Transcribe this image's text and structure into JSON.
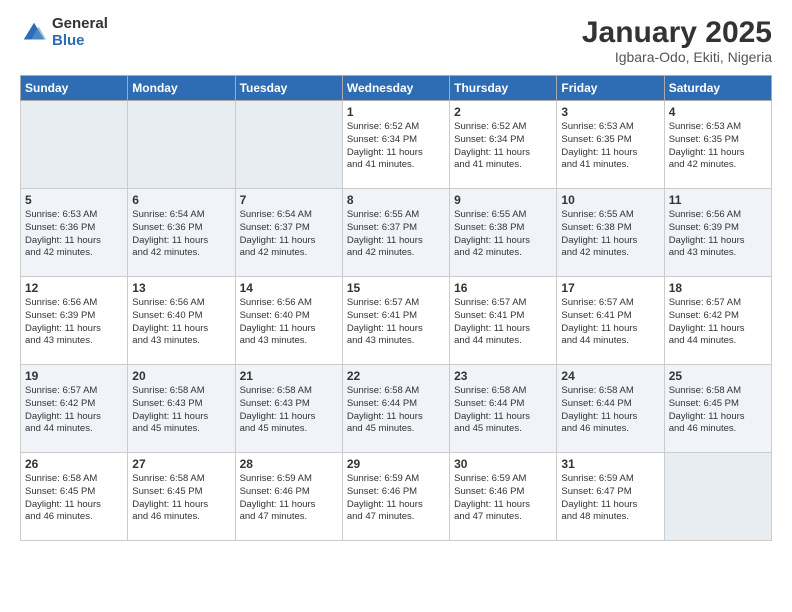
{
  "header": {
    "logo_general": "General",
    "logo_blue": "Blue",
    "title": "January 2025",
    "subtitle": "Igbara-Odo, Ekiti, Nigeria"
  },
  "days_header": [
    "Sunday",
    "Monday",
    "Tuesday",
    "Wednesday",
    "Thursday",
    "Friday",
    "Saturday"
  ],
  "weeks": [
    [
      {
        "day": "",
        "info": ""
      },
      {
        "day": "",
        "info": ""
      },
      {
        "day": "",
        "info": ""
      },
      {
        "day": "1",
        "info": "Sunrise: 6:52 AM\nSunset: 6:34 PM\nDaylight: 11 hours\nand 41 minutes."
      },
      {
        "day": "2",
        "info": "Sunrise: 6:52 AM\nSunset: 6:34 PM\nDaylight: 11 hours\nand 41 minutes."
      },
      {
        "day": "3",
        "info": "Sunrise: 6:53 AM\nSunset: 6:35 PM\nDaylight: 11 hours\nand 41 minutes."
      },
      {
        "day": "4",
        "info": "Sunrise: 6:53 AM\nSunset: 6:35 PM\nDaylight: 11 hours\nand 42 minutes."
      }
    ],
    [
      {
        "day": "5",
        "info": "Sunrise: 6:53 AM\nSunset: 6:36 PM\nDaylight: 11 hours\nand 42 minutes."
      },
      {
        "day": "6",
        "info": "Sunrise: 6:54 AM\nSunset: 6:36 PM\nDaylight: 11 hours\nand 42 minutes."
      },
      {
        "day": "7",
        "info": "Sunrise: 6:54 AM\nSunset: 6:37 PM\nDaylight: 11 hours\nand 42 minutes."
      },
      {
        "day": "8",
        "info": "Sunrise: 6:55 AM\nSunset: 6:37 PM\nDaylight: 11 hours\nand 42 minutes."
      },
      {
        "day": "9",
        "info": "Sunrise: 6:55 AM\nSunset: 6:38 PM\nDaylight: 11 hours\nand 42 minutes."
      },
      {
        "day": "10",
        "info": "Sunrise: 6:55 AM\nSunset: 6:38 PM\nDaylight: 11 hours\nand 42 minutes."
      },
      {
        "day": "11",
        "info": "Sunrise: 6:56 AM\nSunset: 6:39 PM\nDaylight: 11 hours\nand 43 minutes."
      }
    ],
    [
      {
        "day": "12",
        "info": "Sunrise: 6:56 AM\nSunset: 6:39 PM\nDaylight: 11 hours\nand 43 minutes."
      },
      {
        "day": "13",
        "info": "Sunrise: 6:56 AM\nSunset: 6:40 PM\nDaylight: 11 hours\nand 43 minutes."
      },
      {
        "day": "14",
        "info": "Sunrise: 6:56 AM\nSunset: 6:40 PM\nDaylight: 11 hours\nand 43 minutes."
      },
      {
        "day": "15",
        "info": "Sunrise: 6:57 AM\nSunset: 6:41 PM\nDaylight: 11 hours\nand 43 minutes."
      },
      {
        "day": "16",
        "info": "Sunrise: 6:57 AM\nSunset: 6:41 PM\nDaylight: 11 hours\nand 44 minutes."
      },
      {
        "day": "17",
        "info": "Sunrise: 6:57 AM\nSunset: 6:41 PM\nDaylight: 11 hours\nand 44 minutes."
      },
      {
        "day": "18",
        "info": "Sunrise: 6:57 AM\nSunset: 6:42 PM\nDaylight: 11 hours\nand 44 minutes."
      }
    ],
    [
      {
        "day": "19",
        "info": "Sunrise: 6:57 AM\nSunset: 6:42 PM\nDaylight: 11 hours\nand 44 minutes."
      },
      {
        "day": "20",
        "info": "Sunrise: 6:58 AM\nSunset: 6:43 PM\nDaylight: 11 hours\nand 45 minutes."
      },
      {
        "day": "21",
        "info": "Sunrise: 6:58 AM\nSunset: 6:43 PM\nDaylight: 11 hours\nand 45 minutes."
      },
      {
        "day": "22",
        "info": "Sunrise: 6:58 AM\nSunset: 6:44 PM\nDaylight: 11 hours\nand 45 minutes."
      },
      {
        "day": "23",
        "info": "Sunrise: 6:58 AM\nSunset: 6:44 PM\nDaylight: 11 hours\nand 45 minutes."
      },
      {
        "day": "24",
        "info": "Sunrise: 6:58 AM\nSunset: 6:44 PM\nDaylight: 11 hours\nand 46 minutes."
      },
      {
        "day": "25",
        "info": "Sunrise: 6:58 AM\nSunset: 6:45 PM\nDaylight: 11 hours\nand 46 minutes."
      }
    ],
    [
      {
        "day": "26",
        "info": "Sunrise: 6:58 AM\nSunset: 6:45 PM\nDaylight: 11 hours\nand 46 minutes."
      },
      {
        "day": "27",
        "info": "Sunrise: 6:58 AM\nSunset: 6:45 PM\nDaylight: 11 hours\nand 46 minutes."
      },
      {
        "day": "28",
        "info": "Sunrise: 6:59 AM\nSunset: 6:46 PM\nDaylight: 11 hours\nand 47 minutes."
      },
      {
        "day": "29",
        "info": "Sunrise: 6:59 AM\nSunset: 6:46 PM\nDaylight: 11 hours\nand 47 minutes."
      },
      {
        "day": "30",
        "info": "Sunrise: 6:59 AM\nSunset: 6:46 PM\nDaylight: 11 hours\nand 47 minutes."
      },
      {
        "day": "31",
        "info": "Sunrise: 6:59 AM\nSunset: 6:47 PM\nDaylight: 11 hours\nand 48 minutes."
      },
      {
        "day": "",
        "info": ""
      }
    ]
  ]
}
